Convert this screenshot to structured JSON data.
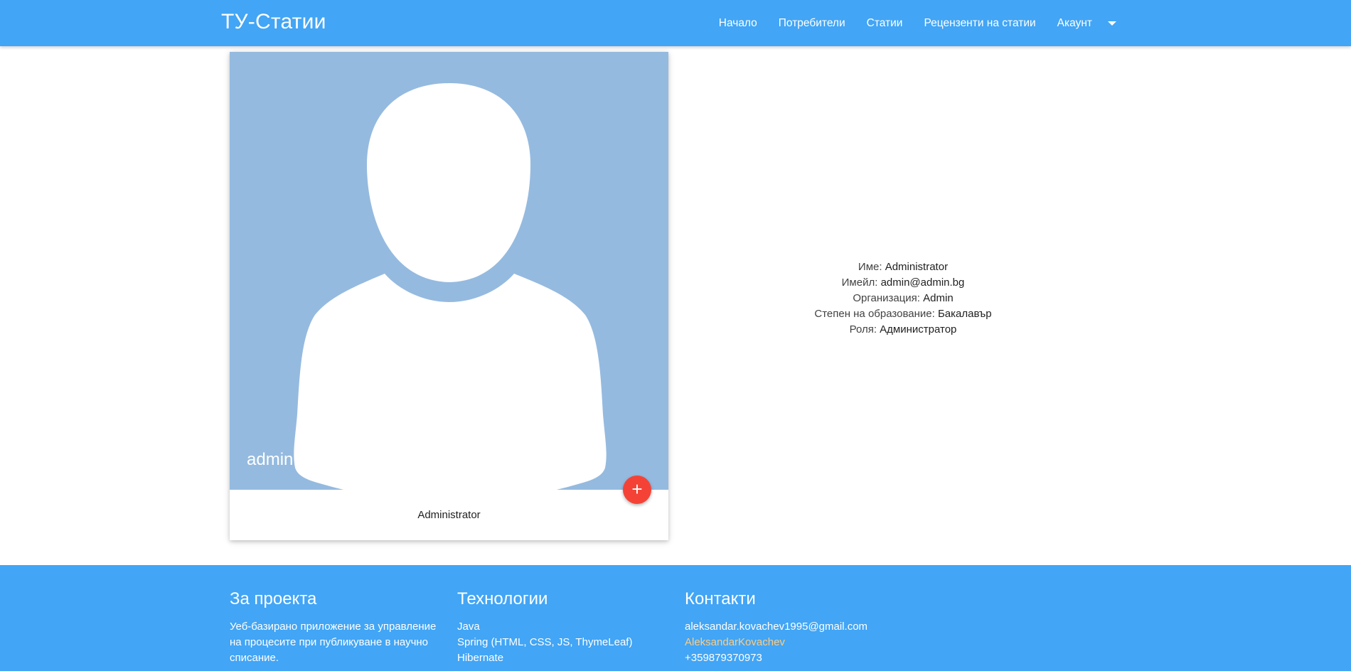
{
  "navbar": {
    "brand": "ТУ-Статии",
    "links": [
      "Начало",
      "Потребители",
      "Статии",
      "Рецензенти на статии",
      "Акаунт"
    ]
  },
  "card": {
    "image_title": "admin",
    "fab_label": "+",
    "caption": "Administrator"
  },
  "info": {
    "name_label": "Име:",
    "name_value": "Administrator",
    "email_label": "Имейл:",
    "email_value": "admin@admin.bg",
    "org_label": "Организация:",
    "org_value": "Admin",
    "edu_label": "Степен на образование:",
    "edu_value": "Бакалавър",
    "role_label": "Роля:",
    "role_value": "Администратор"
  },
  "footer": {
    "about_title": "За проекта",
    "about_text": "Уеб-базирано приложение за управление на процесите при публикуване в научно списание.",
    "tech_title": "Технологии",
    "tech_items": [
      "Java",
      "Spring (HTML, CSS, JS, ThymeLeaf)",
      "Hibernate"
    ],
    "contacts_title": "Контакти",
    "contact_email": "aleksandar.kovachev1995@gmail.com",
    "contact_github": "AleksandarKovachev",
    "contact_phone": "+359879370973"
  },
  "colors": {
    "primary": "#42a5f5",
    "avatar_bg": "#95badf",
    "fab": "#f44336",
    "link_accent": "#ffcc80"
  },
  "icons": {
    "avatar": "user-silhouette-icon",
    "dropdown": "caret-down-icon",
    "fab": "plus-icon"
  }
}
